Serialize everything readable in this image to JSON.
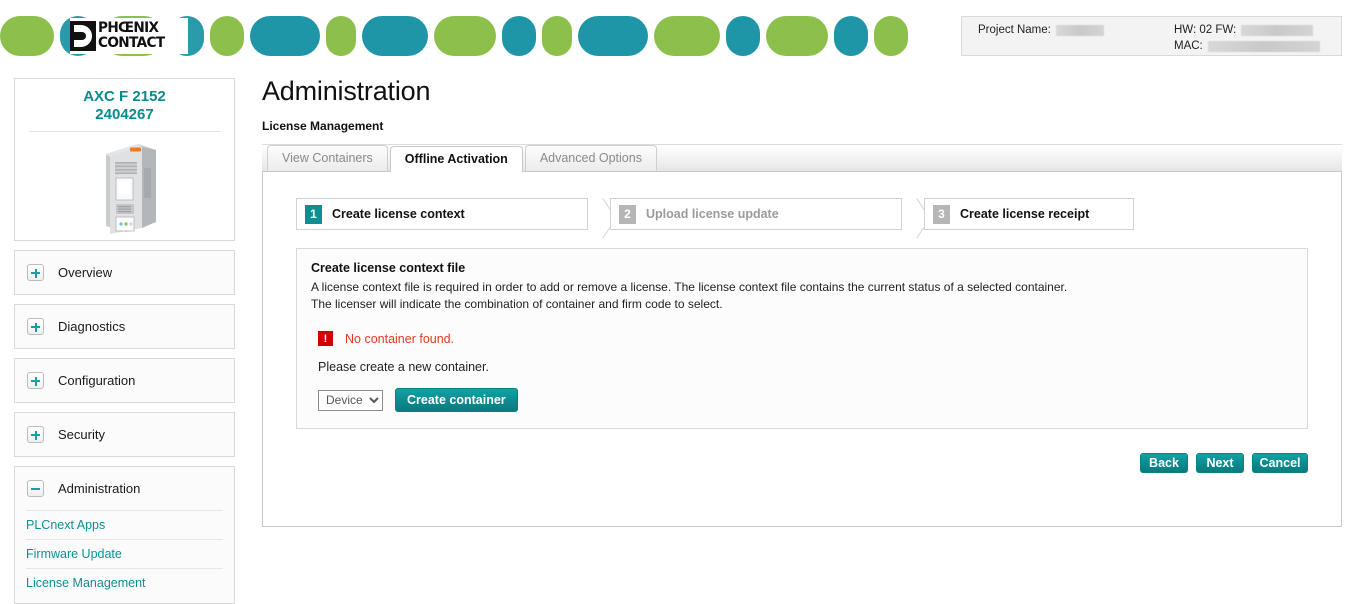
{
  "banner": {
    "logo_line1": "PHŒNIX",
    "logo_line2": "CONTACT",
    "pills": [
      {
        "color": "#8cc04b",
        "width": 54
      },
      {
        "color": "#2a9bab",
        "width": 36
      },
      {
        "color": "#8cc04b",
        "width": 62
      },
      {
        "color": "#2a9bab",
        "width": 34
      },
      {
        "color": "#8cc04b",
        "width": 34
      },
      {
        "color": "#1f96a8",
        "width": 70
      },
      {
        "color": "#8cc04b",
        "width": 30
      },
      {
        "color": "#1f96a8",
        "width": 66
      },
      {
        "color": "#8cc04b",
        "width": 62
      },
      {
        "color": "#1f96a8",
        "width": 34
      },
      {
        "color": "#8cc04b",
        "width": 30
      },
      {
        "color": "#1f96a8",
        "width": 70
      },
      {
        "color": "#8cc04b",
        "width": 66
      },
      {
        "color": "#1f96a8",
        "width": 34
      },
      {
        "color": "#8cc04b",
        "width": 62
      },
      {
        "color": "#1f96a8",
        "width": 34
      },
      {
        "color": "#8cc04b",
        "width": 34
      }
    ]
  },
  "project_info": {
    "project_name_label": "Project Name:",
    "project_name_value": "",
    "hw_label": "HW: 02 FW:",
    "hw_value": "",
    "mac_label": "MAC:",
    "mac_value": ""
  },
  "sidebar": {
    "device_name": "AXC F 2152",
    "device_order_no": "2404267",
    "groups": [
      {
        "label": "Overview",
        "expanded": false,
        "icon": "plus-icon"
      },
      {
        "label": "Diagnostics",
        "expanded": false,
        "icon": "plus-icon"
      },
      {
        "label": "Configuration",
        "expanded": false,
        "icon": "plus-icon"
      },
      {
        "label": "Security",
        "expanded": false,
        "icon": "plus-icon"
      },
      {
        "label": "Administration",
        "expanded": true,
        "icon": "minus-icon"
      }
    ],
    "admin_items": [
      {
        "label": "PLCnext Apps"
      },
      {
        "label": "Firmware Update"
      },
      {
        "label": "License Management"
      }
    ]
  },
  "main": {
    "page_title": "Administration",
    "breadcrumb": "License Management",
    "tabs": [
      {
        "label": "View Containers",
        "active": false
      },
      {
        "label": "Offline Activation",
        "active": true
      },
      {
        "label": "Advanced Options",
        "active": false
      }
    ],
    "steps": [
      {
        "num": "1",
        "label": "Create license context",
        "active": true
      },
      {
        "num": "2",
        "label": "Upload license update",
        "active": false
      },
      {
        "num": "3",
        "label": "Create license receipt",
        "active": false
      }
    ],
    "section": {
      "heading": "Create license context file",
      "paragraph_line1": "A license context file is required in order to add or remove a license. The license context file contains the current status of a selected container.",
      "paragraph_line2": "The licenser will indicate the combination of container and firm code to select.",
      "error_icon_glyph": "!",
      "error_text": "No container found.",
      "hint_text": "Please create a new container.",
      "select_value": "Device",
      "select_options": [
        "Device"
      ],
      "create_button": "Create container"
    },
    "footer": {
      "back": "Back",
      "next": "Next",
      "cancel": "Cancel"
    }
  },
  "colors": {
    "teal": "#0d8f93",
    "green": "#8cc04b",
    "error_red": "#e23b25",
    "error_badge": "#d40000"
  }
}
